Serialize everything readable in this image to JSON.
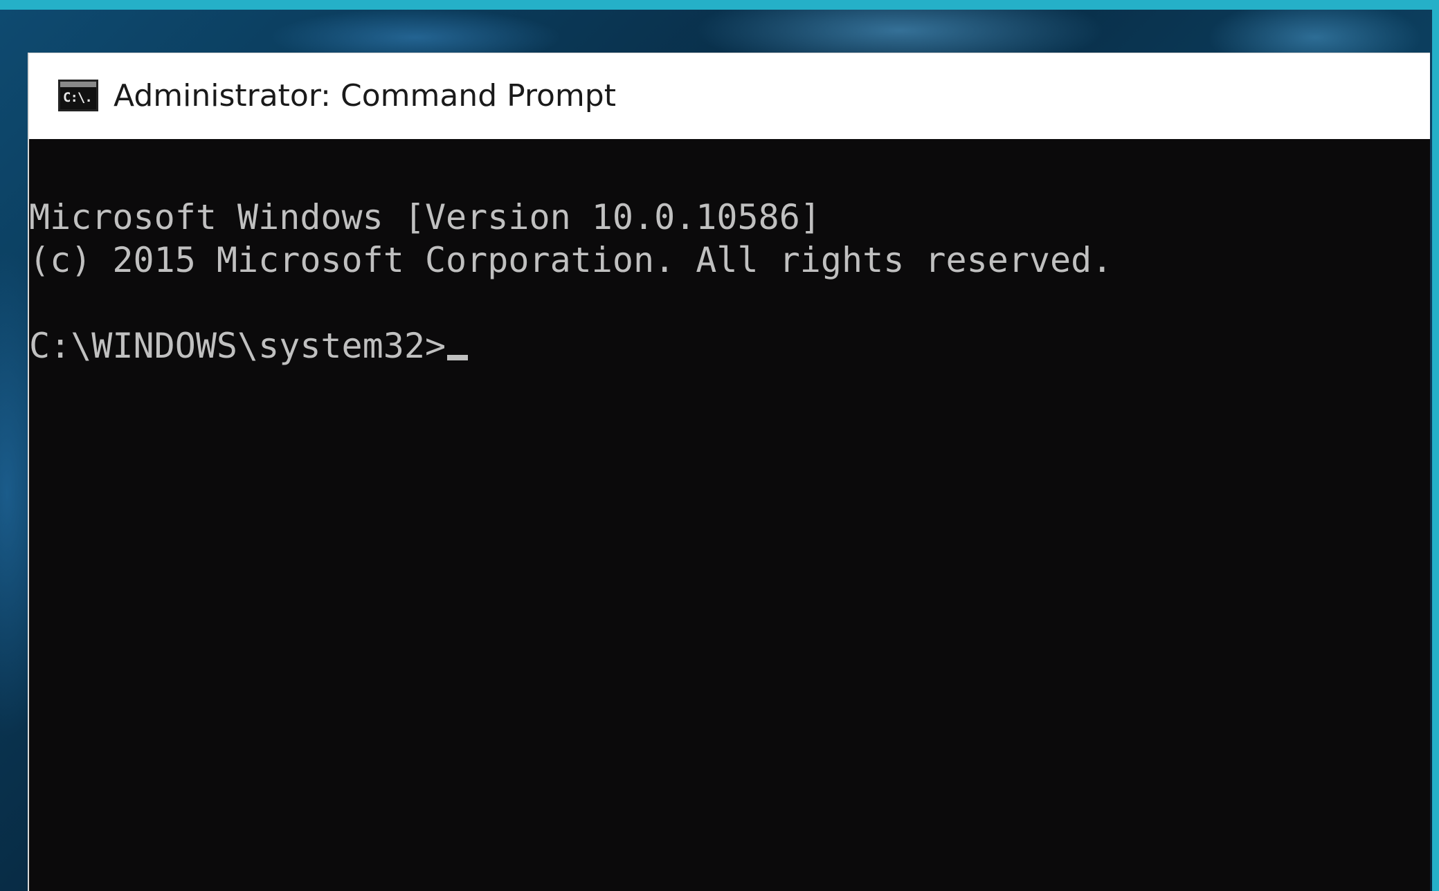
{
  "window": {
    "title": "Administrator: Command Prompt",
    "icon": "cmd-icon",
    "icon_glyph": "C:\\."
  },
  "console": {
    "lines": [
      "Microsoft Windows [Version 10.0.10586]",
      "(c) 2015 Microsoft Corporation. All rights reserved.",
      "",
      "C:\\WINDOWS\\system32>"
    ]
  },
  "colors": {
    "console_background": "#0b0a0b",
    "console_text": "#c0c0c0",
    "titlebar_background": "#ffffff",
    "accent_border": "#25b0c8"
  }
}
